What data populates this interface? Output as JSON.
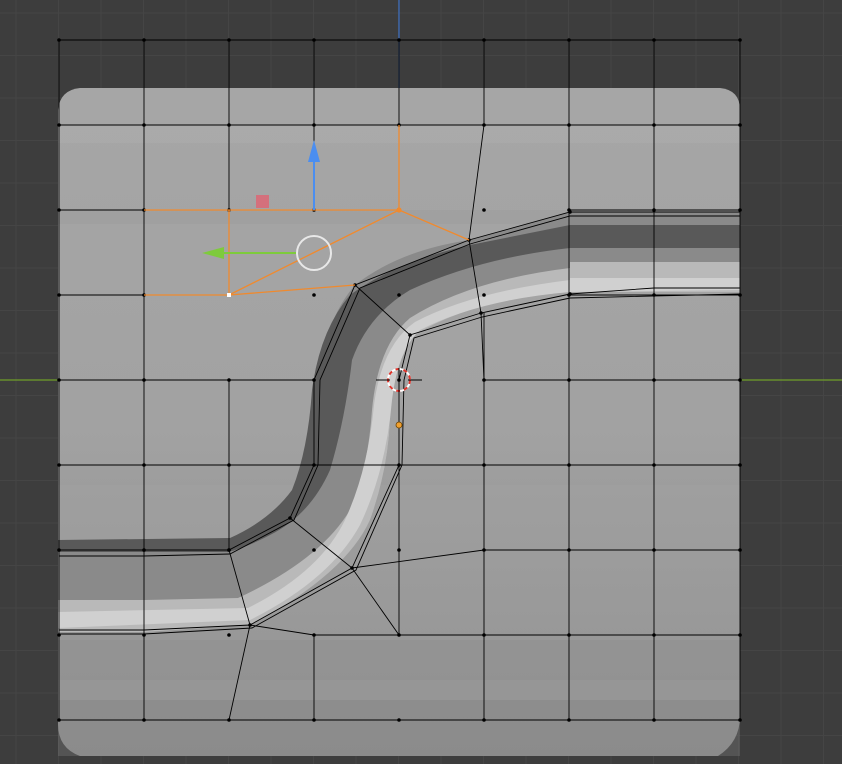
{
  "viewport": {
    "mode": "edit-mode-vertex-select",
    "view": "top-orthographic",
    "colors": {
      "background": "#3d3d3d",
      "grid_line": "#454545",
      "mesh_light": "#a2a2a2",
      "mesh_dark": "#4e4e4e",
      "wire": "#000000",
      "selected": "#f08a2e",
      "active_vertex": "#ffffff",
      "axis_x": "#6f9e2a",
      "axis_y": "#3c6fc2",
      "gizmo_z": "#4b8ef0",
      "gizmo_y": "#7ecb3c",
      "gizmo_x_plane": "#d96a78",
      "cursor_red": "#e0352c"
    }
  },
  "gizmo": {
    "type": "move-transform-gizmo",
    "handles": [
      "y-axis-arrow",
      "x-axis-arrow",
      "xz-plane-handle",
      "view-center-ring"
    ]
  },
  "cursor": {
    "type": "3d-cursor"
  },
  "origin": {
    "type": "object-origin"
  }
}
